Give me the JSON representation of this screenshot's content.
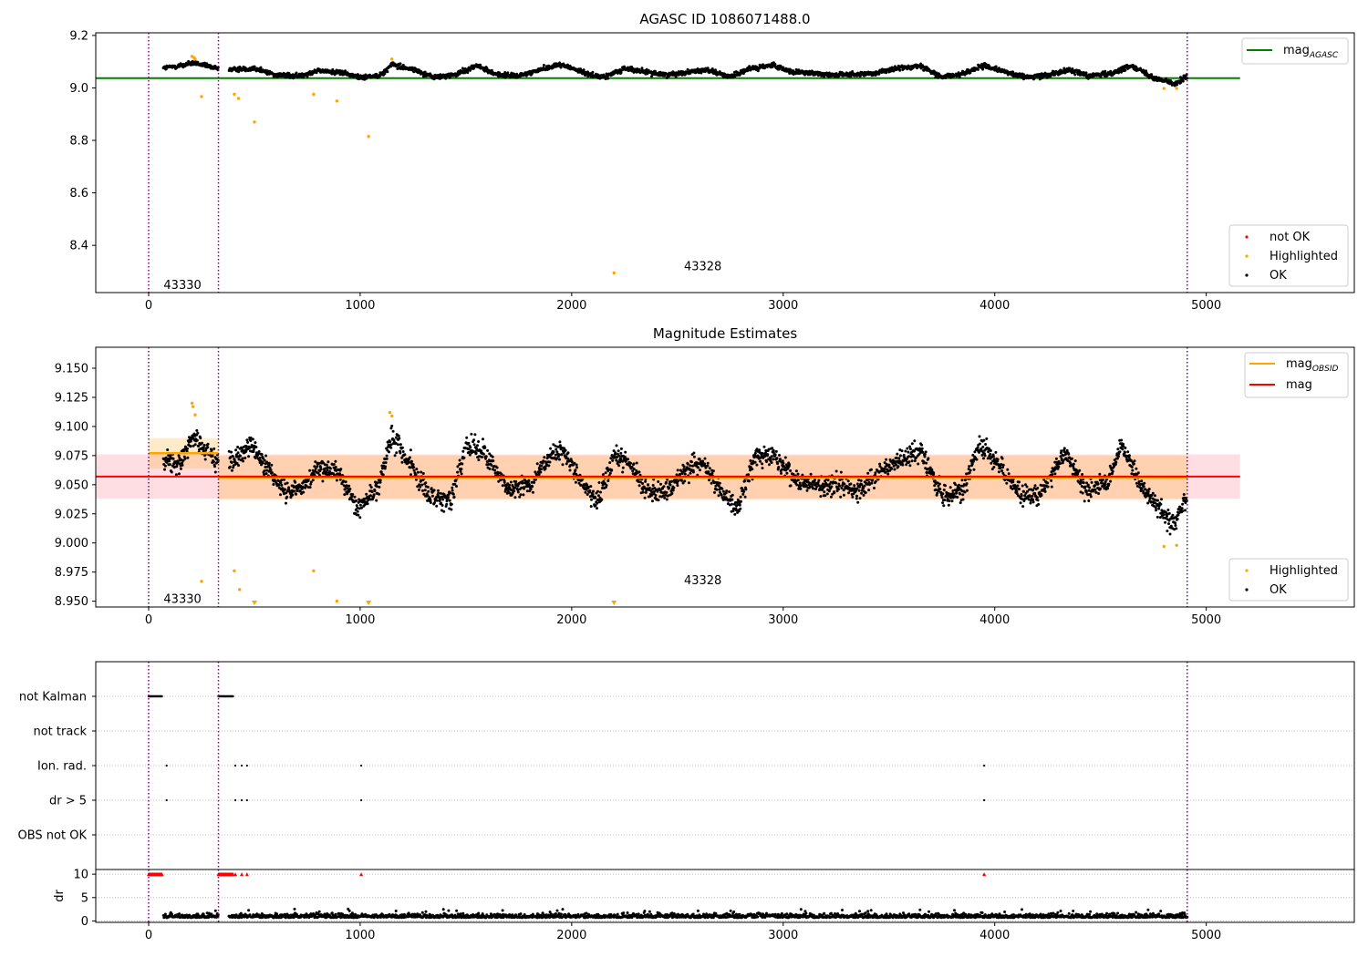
{
  "chart_data": [
    {
      "type": "scatter",
      "title": "AGASC ID 1086071488.0",
      "xlim": [
        -250,
        5700
      ],
      "ylim": [
        8.22,
        9.21
      ],
      "x_ticks": [
        0,
        1000,
        2000,
        3000,
        4000,
        5000
      ],
      "y_ticks": [
        8.4,
        8.6,
        8.8,
        9.0,
        9.2
      ],
      "grid": false,
      "legend_top": {
        "position": "top-right",
        "entries": [
          {
            "label": "mag",
            "subscript": "AGASC",
            "color": "#008000"
          }
        ]
      },
      "legend_bottom": {
        "position": "bottom-right",
        "entries": [
          {
            "label": "not OK",
            "color": "#ff0000"
          },
          {
            "label": "Highlighted",
            "color": "#ffa500"
          },
          {
            "label": "OK",
            "color": "#000000"
          }
        ]
      },
      "mag_agasc": 9.037,
      "mag_agasc_x_range": [
        -250,
        5160
      ],
      "obsid_boundaries": [
        0,
        330,
        4910
      ],
      "obsid_labels": [
        {
          "text": "43330",
          "x": 160,
          "y": 8.25
        },
        {
          "text": "43328",
          "x": 2620,
          "y": 8.32
        }
      ],
      "ok_trend": [
        [
          70,
          9.075
        ],
        [
          150,
          9.085
        ],
        [
          210,
          9.095
        ],
        [
          320,
          9.075
        ],
        [
          400,
          9.07
        ],
        [
          500,
          9.075
        ],
        [
          600,
          9.05
        ],
        [
          700,
          9.045
        ],
        [
          800,
          9.065
        ],
        [
          900,
          9.06
        ],
        [
          1000,
          9.04
        ],
        [
          1100,
          9.05
        ],
        [
          1150,
          9.09
        ],
        [
          1250,
          9.07
        ],
        [
          1350,
          9.04
        ],
        [
          1450,
          9.05
        ],
        [
          1550,
          9.085
        ],
        [
          1650,
          9.05
        ],
        [
          1750,
          9.045
        ],
        [
          1850,
          9.07
        ],
        [
          1950,
          9.09
        ],
        [
          2050,
          9.06
        ],
        [
          2150,
          9.04
        ],
        [
          2250,
          9.075
        ],
        [
          2350,
          9.06
        ],
        [
          2450,
          9.05
        ],
        [
          2550,
          9.06
        ],
        [
          2650,
          9.07
        ],
        [
          2750,
          9.04
        ],
        [
          2850,
          9.075
        ],
        [
          2950,
          9.085
        ],
        [
          3050,
          9.06
        ],
        [
          3150,
          9.055
        ],
        [
          3250,
          9.05
        ],
        [
          3350,
          9.05
        ],
        [
          3450,
          9.06
        ],
        [
          3550,
          9.075
        ],
        [
          3650,
          9.085
        ],
        [
          3750,
          9.04
        ],
        [
          3850,
          9.055
        ],
        [
          3950,
          9.085
        ],
        [
          4050,
          9.06
        ],
        [
          4150,
          9.04
        ],
        [
          4250,
          9.05
        ],
        [
          4350,
          9.07
        ],
        [
          4450,
          9.045
        ],
        [
          4550,
          9.055
        ],
        [
          4650,
          9.085
        ],
        [
          4750,
          9.04
        ],
        [
          4850,
          9.015
        ],
        [
          4910,
          9.045
        ]
      ],
      "highlighted_points": [
        [
          205,
          9.12
        ],
        [
          215,
          9.115
        ],
        [
          220,
          9.11
        ],
        [
          250,
          8.967
        ],
        [
          405,
          8.976
        ],
        [
          425,
          8.96
        ],
        [
          500,
          8.87
        ],
        [
          780,
          8.976
        ],
        [
          890,
          8.95
        ],
        [
          1040,
          8.815
        ],
        [
          1150,
          9.11
        ],
        [
          2200,
          8.295
        ],
        [
          4800,
          8.998
        ],
        [
          4860,
          8.998
        ]
      ],
      "not_ok_points": []
    },
    {
      "type": "scatter",
      "title": "Magnitude Estimates",
      "xlim": [
        -250,
        5700
      ],
      "ylim": [
        8.945,
        9.168
      ],
      "x_ticks": [
        0,
        1000,
        2000,
        3000,
        4000,
        5000
      ],
      "y_ticks": [
        8.95,
        8.975,
        9.0,
        9.025,
        9.05,
        9.075,
        9.1,
        9.125,
        9.15
      ],
      "y_tick_labels": [
        "8.950",
        "8.975",
        "9.000",
        "9.025",
        "9.050",
        "9.075",
        "9.100",
        "9.125",
        "9.150"
      ],
      "grid": false,
      "legend_top": {
        "position": "top-right",
        "entries": [
          {
            "label": "mag",
            "subscript": "OBSID",
            "color": "#ffa500"
          },
          {
            "label": "mag",
            "color": "#ff0000"
          }
        ]
      },
      "legend_bottom": {
        "position": "bottom-right",
        "entries": [
          {
            "label": "Highlighted",
            "color": "#ffa500"
          },
          {
            "label": "OK",
            "color": "#000000"
          }
        ]
      },
      "mag": 9.057,
      "mag_band": [
        9.038,
        9.076
      ],
      "mag_x_range": [
        -250,
        5160
      ],
      "mag_obsid": [
        {
          "x0": 0,
          "x1": 330,
          "value": 9.077,
          "band": [
            9.064,
            9.09
          ]
        },
        {
          "x0": 330,
          "x1": 4910,
          "value": 9.056,
          "band": [
            9.037,
            9.075
          ]
        }
      ],
      "obsid_boundaries": [
        0,
        330,
        4910
      ],
      "obsid_labels": [
        {
          "text": "43330",
          "x": 160,
          "y": 8.952
        },
        {
          "text": "43328",
          "x": 2620,
          "y": 8.968
        }
      ],
      "ok_trend": [
        [
          70,
          9.07
        ],
        [
          150,
          9.07
        ],
        [
          210,
          9.09
        ],
        [
          320,
          9.07
        ],
        [
          400,
          9.07
        ],
        [
          480,
          9.085
        ],
        [
          560,
          9.065
        ],
        [
          640,
          9.045
        ],
        [
          720,
          9.045
        ],
        [
          800,
          9.065
        ],
        [
          900,
          9.06
        ],
        [
          980,
          9.03
        ],
        [
          1080,
          9.045
        ],
        [
          1150,
          9.09
        ],
        [
          1250,
          9.065
        ],
        [
          1330,
          9.04
        ],
        [
          1430,
          9.035
        ],
        [
          1500,
          9.085
        ],
        [
          1600,
          9.075
        ],
        [
          1700,
          9.045
        ],
        [
          1800,
          9.05
        ],
        [
          1900,
          9.075
        ],
        [
          1950,
          9.08
        ],
        [
          2050,
          9.05
        ],
        [
          2120,
          9.035
        ],
        [
          2200,
          9.075
        ],
        [
          2270,
          9.07
        ],
        [
          2350,
          9.045
        ],
        [
          2450,
          9.045
        ],
        [
          2550,
          9.065
        ],
        [
          2620,
          9.07
        ],
        [
          2700,
          9.045
        ],
        [
          2780,
          9.03
        ],
        [
          2870,
          9.075
        ],
        [
          2950,
          9.075
        ],
        [
          3050,
          9.055
        ],
        [
          3150,
          9.05
        ],
        [
          3250,
          9.05
        ],
        [
          3350,
          9.045
        ],
        [
          3450,
          9.06
        ],
        [
          3550,
          9.07
        ],
        [
          3650,
          9.08
        ],
        [
          3750,
          9.04
        ],
        [
          3850,
          9.045
        ],
        [
          3930,
          9.085
        ],
        [
          4030,
          9.065
        ],
        [
          4120,
          9.04
        ],
        [
          4200,
          9.04
        ],
        [
          4280,
          9.06
        ],
        [
          4330,
          9.08
        ],
        [
          4430,
          9.045
        ],
        [
          4530,
          9.05
        ],
        [
          4600,
          9.085
        ],
        [
          4700,
          9.045
        ],
        [
          4780,
          9.03
        ],
        [
          4850,
          9.015
        ],
        [
          4910,
          9.04
        ]
      ],
      "highlighted_points": [
        [
          205,
          9.12
        ],
        [
          210,
          9.117
        ],
        [
          220,
          9.11
        ],
        [
          250,
          8.967
        ],
        [
          405,
          8.976
        ],
        [
          430,
          8.96
        ],
        [
          780,
          8.976
        ],
        [
          890,
          8.95
        ],
        [
          1140,
          9.112
        ],
        [
          1150,
          9.109
        ],
        [
          4800,
          8.997
        ],
        [
          4860,
          8.998
        ]
      ],
      "clipped_markers_x": [
        500,
        1040,
        2200
      ]
    },
    {
      "type": "scatter",
      "xlim": [
        -250,
        5700
      ],
      "x_ticks": [
        0,
        1000,
        2000,
        3000,
        4000,
        5000
      ],
      "flag_rows": [
        "not Kalman",
        "not track",
        "Ion. rad.",
        "dr > 5",
        "OBS not OK"
      ],
      "flags": {
        "not Kalman": [
          [
            0,
            65
          ],
          [
            330,
            400
          ]
        ],
        "not track": [],
        "Ion. rad.": [
          85,
          410,
          440,
          465,
          1005,
          3950
        ],
        "dr > 5": [
          85,
          410,
          440,
          465,
          1005,
          3950
        ],
        "OBS not OK": []
      },
      "obsid_boundaries": [
        0,
        330,
        4910
      ]
    },
    {
      "type": "scatter",
      "ylabel": "dr",
      "xlim": [
        -250,
        5700
      ],
      "ylim": [
        -0.3,
        11
      ],
      "x_ticks": [
        0,
        1000,
        2000,
        3000,
        4000,
        5000
      ],
      "y_ticks": [
        0,
        5,
        10
      ],
      "dr_large_x": [
        [
          0,
          65
        ],
        [
          330,
          400
        ],
        410,
        440,
        465,
        1005,
        3950
      ],
      "dr_clip_value": 10,
      "dr_level": 1.0,
      "dr_spread": 0.9,
      "dr_segments": [
        [
          70,
          330
        ],
        [
          380,
          4910
        ]
      ],
      "obsid_boundaries": [
        0,
        330,
        4910
      ]
    }
  ],
  "colors": {
    "ok": "#000000",
    "highlighted": "#ffa500",
    "not_ok": "#ff0000",
    "agasc_line": "#008000",
    "mag_line": "#ff0000",
    "mag_band": "#ffb6c1",
    "mag_obsid_line": "#ffa500",
    "obsid_boundary": "#800080",
    "grid": "#b0b0b0"
  }
}
